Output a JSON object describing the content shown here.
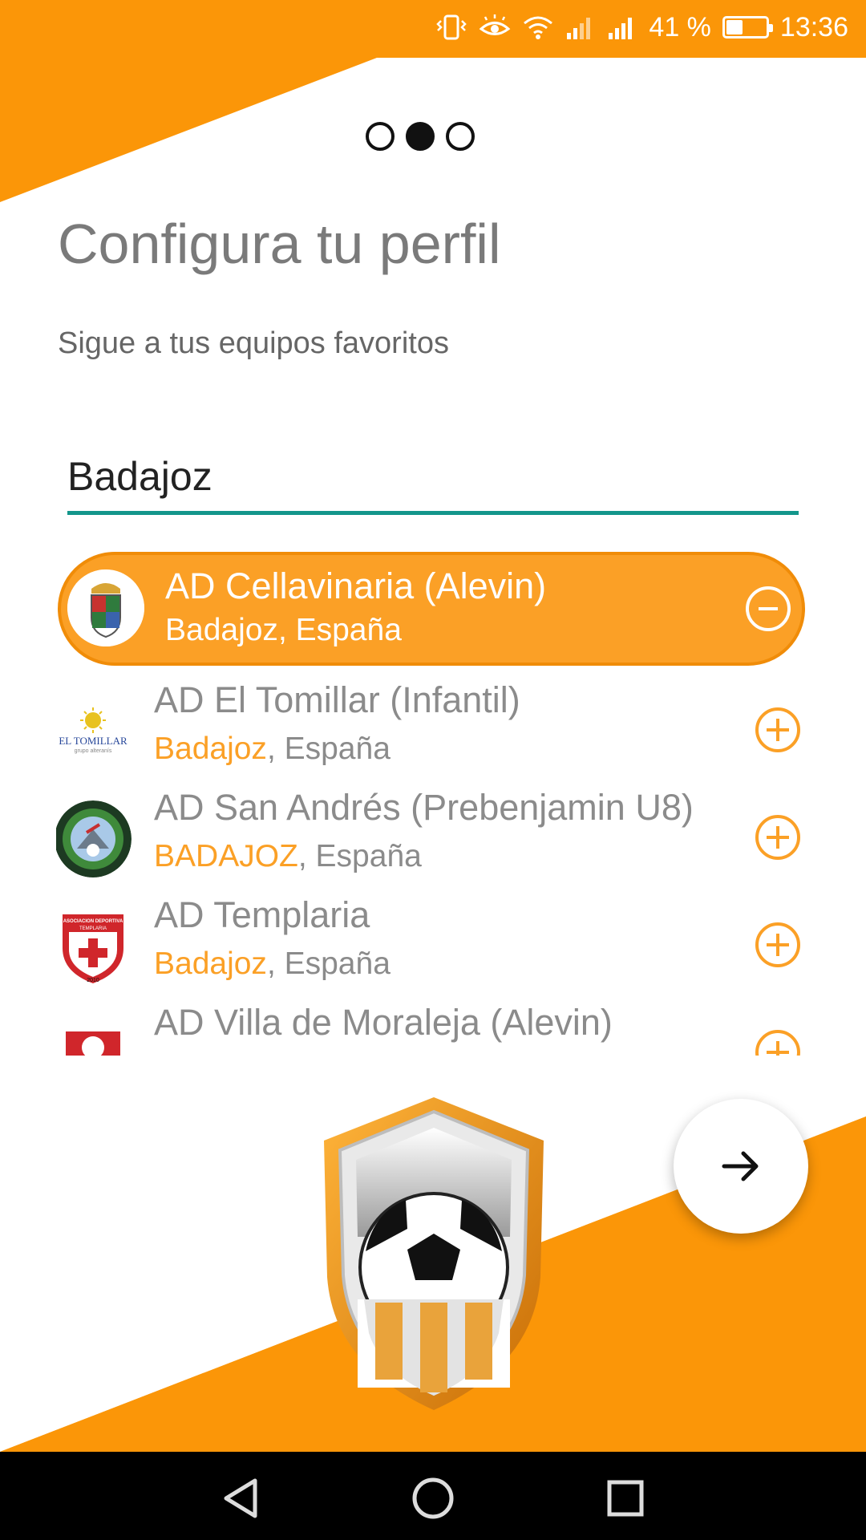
{
  "status_bar": {
    "battery_percent": "41 %",
    "time": "13:36",
    "battery_level": 0.41
  },
  "pager": {
    "total": 3,
    "active_index": 1
  },
  "page": {
    "title": "Configura tu perfil",
    "subtitle": "Sigue a tus equipos favoritos"
  },
  "search": {
    "value": "Badajoz"
  },
  "teams": [
    {
      "name": "AD Cellavinaria (Alevin)",
      "city": "Badajoz",
      "country": ", España",
      "selected": true,
      "action": "remove"
    },
    {
      "name": "AD El Tomillar (Infantil)",
      "city": "Badajoz",
      "country": ", España",
      "selected": false,
      "action": "add",
      "logo_text": "EL TOMILLAR",
      "logo_subtext": "grupo alteranís"
    },
    {
      "name": "AD San Andrés (Prebenjamin U8)",
      "city": "BADAJOZ",
      "country": ", España",
      "selected": false,
      "action": "add"
    },
    {
      "name": "AD Templaria",
      "city": "Badajoz",
      "country": ", España",
      "selected": false,
      "action": "add",
      "logo_text": "ASOCIACION DEPORTIVA",
      "logo_subtext": "TEMPLARIA",
      "logo_year": "2010"
    },
    {
      "name": "AD Villa de Moraleja (Alevin)",
      "city": "",
      "country": "",
      "selected": false,
      "action": "add"
    }
  ],
  "colors": {
    "accent": "#fb9608",
    "accent_light": "#fba026",
    "teal": "#13968b",
    "title_gray": "#7a7a7a"
  }
}
